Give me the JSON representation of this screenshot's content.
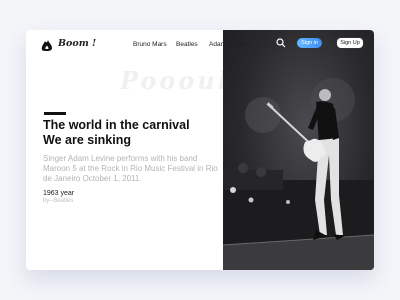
{
  "header": {
    "brand": "Boom !",
    "nav": [
      "Bruno Mars",
      "Beatles",
      "Adam Levine"
    ],
    "signin_label": "Sign in",
    "signup_label": "Sign Up"
  },
  "hero": {
    "watermark": "Poooul",
    "headline_line1": "The world in the carnival",
    "headline_line2": "We are sinking",
    "body": "Singer Adam Levine performs with his band Maroon 5 at the Rock in Rio Music Festival in Rio de Janeiro October 1, 2011.",
    "year": "1963 year",
    "by": "by--Beatles"
  },
  "icons": {
    "logo": "boom-logo-icon",
    "search": "search-icon"
  },
  "colors": {
    "accent": "#3b8cf6",
    "text": "#111111",
    "muted": "#b4b4b8",
    "photo_bg": "#29292c"
  }
}
